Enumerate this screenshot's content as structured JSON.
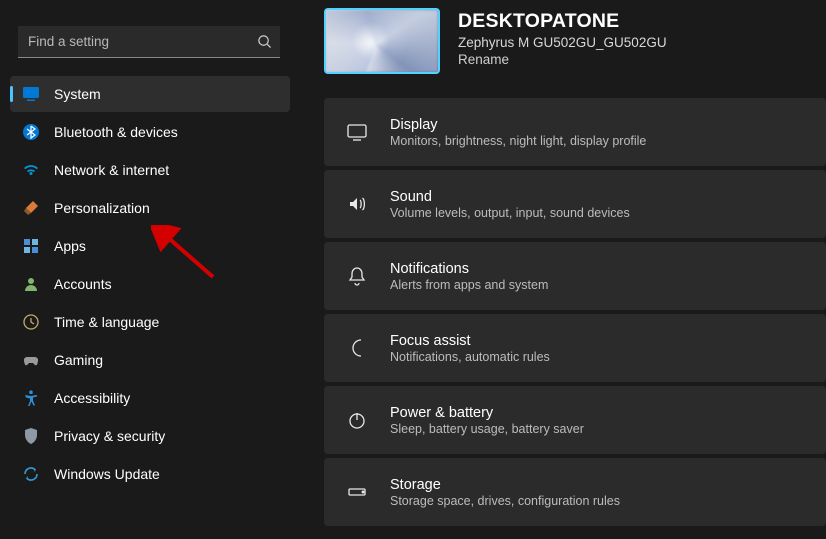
{
  "search": {
    "placeholder": "Find a setting"
  },
  "nav": [
    {
      "id": "system",
      "label": "System",
      "icon": "system-icon",
      "selected": true
    },
    {
      "id": "bluetooth",
      "label": "Bluetooth & devices",
      "icon": "bluetooth-icon",
      "selected": false
    },
    {
      "id": "network",
      "label": "Network & internet",
      "icon": "wifi-icon",
      "selected": false
    },
    {
      "id": "personalization",
      "label": "Personalization",
      "icon": "paintbrush-icon",
      "selected": false
    },
    {
      "id": "apps",
      "label": "Apps",
      "icon": "apps-icon",
      "selected": false
    },
    {
      "id": "accounts",
      "label": "Accounts",
      "icon": "person-icon",
      "selected": false
    },
    {
      "id": "time",
      "label": "Time & language",
      "icon": "clock-icon",
      "selected": false
    },
    {
      "id": "gaming",
      "label": "Gaming",
      "icon": "controller-icon",
      "selected": false
    },
    {
      "id": "accessibility",
      "label": "Accessibility",
      "icon": "accessibility-icon",
      "selected": false
    },
    {
      "id": "privacy",
      "label": "Privacy & security",
      "icon": "shield-icon",
      "selected": false
    },
    {
      "id": "update",
      "label": "Windows Update",
      "icon": "update-icon",
      "selected": false
    }
  ],
  "device": {
    "name": "DESKTOPATONE",
    "model": "Zephyrus M GU502GU_GU502GU",
    "rename_label": "Rename"
  },
  "cards": [
    {
      "id": "display",
      "title": "Display",
      "subtitle": "Monitors, brightness, night light, display profile",
      "icon": "display-icon"
    },
    {
      "id": "sound",
      "title": "Sound",
      "subtitle": "Volume levels, output, input, sound devices",
      "icon": "sound-icon"
    },
    {
      "id": "notifications",
      "title": "Notifications",
      "subtitle": "Alerts from apps and system",
      "icon": "bell-icon"
    },
    {
      "id": "focus",
      "title": "Focus assist",
      "subtitle": "Notifications, automatic rules",
      "icon": "moon-icon"
    },
    {
      "id": "power",
      "title": "Power & battery",
      "subtitle": "Sleep, battery usage, battery saver",
      "icon": "power-icon"
    },
    {
      "id": "storage",
      "title": "Storage",
      "subtitle": "Storage space, drives, configuration rules",
      "icon": "storage-icon"
    }
  ]
}
